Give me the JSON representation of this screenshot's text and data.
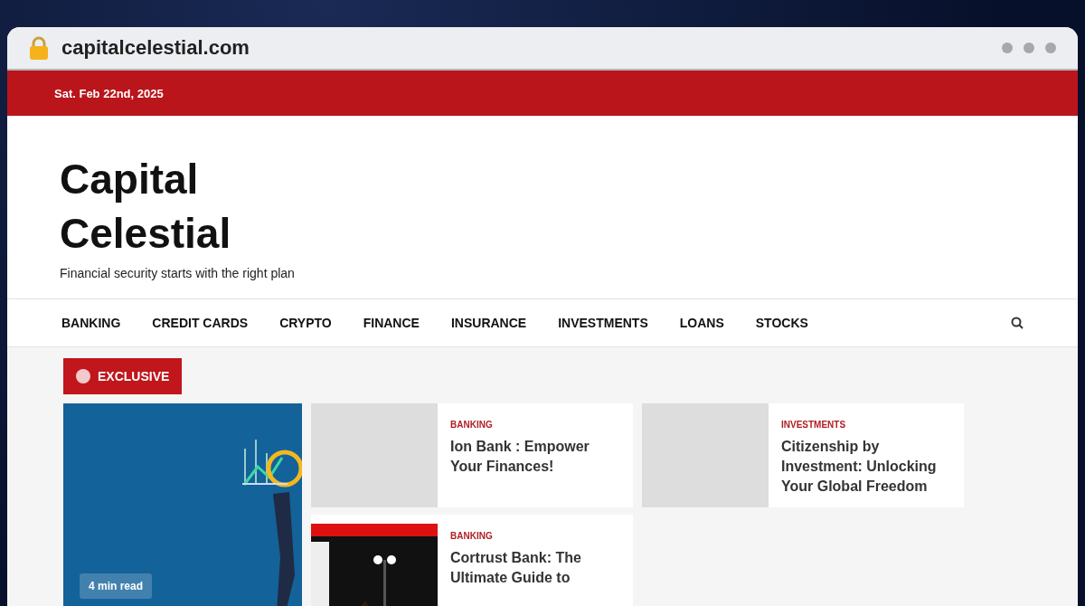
{
  "browser": {
    "url": "capitalcelestial.com"
  },
  "top_bar": {
    "date": "Sat. Feb 22nd, 2025"
  },
  "site": {
    "title": "Capital Celestial",
    "tagline": "Financial security starts with the right plan"
  },
  "nav": {
    "items": [
      {
        "label": "BANKING"
      },
      {
        "label": "CREDIT CARDS"
      },
      {
        "label": "CRYPTO"
      },
      {
        "label": "FINANCE"
      },
      {
        "label": "INSURANCE"
      },
      {
        "label": "INVESTMENTS"
      },
      {
        "label": "LOANS"
      },
      {
        "label": "STOCKS"
      }
    ]
  },
  "exclusive": {
    "label": "EXCLUSIVE"
  },
  "featured": {
    "kind": "picture",
    "read_time": "4 min read"
  },
  "posts": [
    {
      "category": "BANKING",
      "title": "Ion Bank : Empower Your Finances!",
      "kind": "placeholder"
    },
    {
      "category": "INVESTMENTS",
      "title": "Citizenship by Investment: Unlocking Your Global Freedom",
      "kind": "placeholder"
    },
    {
      "category": "BANKING",
      "title": "Cortrust Bank: The Ultimate Guide to",
      "kind": "picture"
    }
  ]
}
